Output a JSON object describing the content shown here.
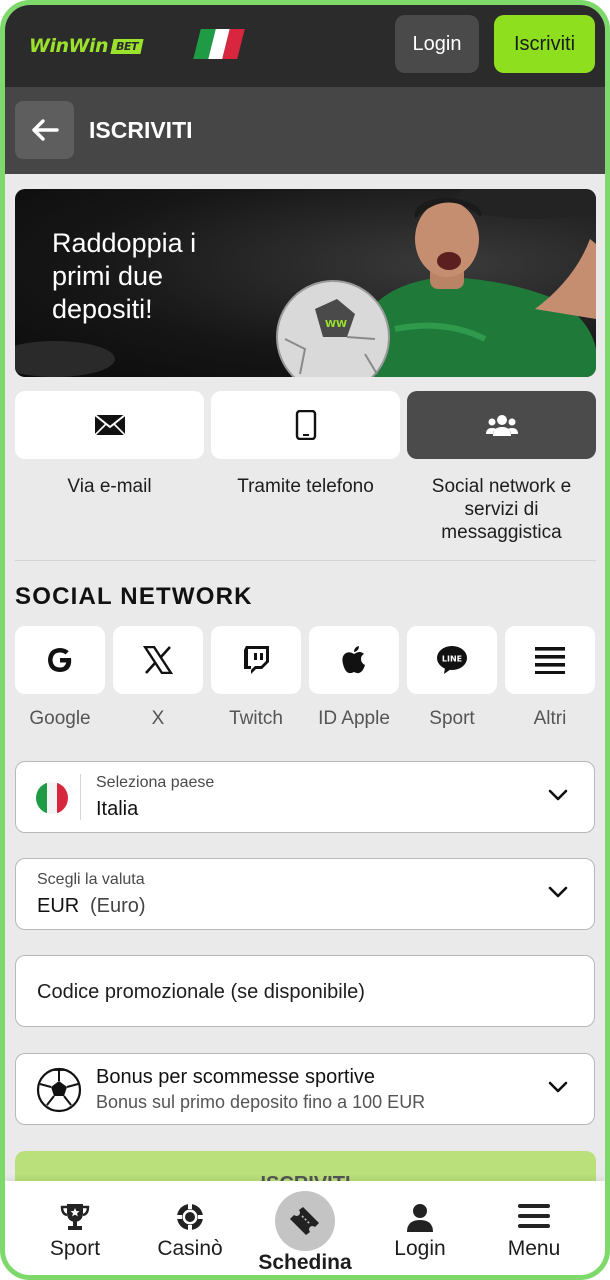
{
  "header": {
    "logo_text": "WinWin",
    "logo_badge": "BET",
    "country_flag": "italy-flag-icon",
    "login_label": "Login",
    "signup_label": "Iscriviti"
  },
  "titlebar": {
    "title": "ISCRIVITI"
  },
  "banner": {
    "headline": "Raddoppia i primi due depositi!"
  },
  "methods": [
    {
      "label": "Via e-mail",
      "icon": "envelope-icon"
    },
    {
      "label": "Tramite telefono",
      "icon": "phone-icon"
    },
    {
      "label": "Social network e servizi di messaggistica",
      "icon": "users-icon"
    }
  ],
  "social_section": {
    "title": "SOCIAL NETWORK",
    "items": [
      {
        "label": "Google",
        "icon": "google-icon"
      },
      {
        "label": "X",
        "icon": "x-icon"
      },
      {
        "label": "Twitch",
        "icon": "twitch-icon"
      },
      {
        "label": "ID Apple",
        "icon": "apple-icon"
      },
      {
        "label": "Sport",
        "icon": "line-icon"
      },
      {
        "label": "Altri",
        "icon": "menu-icon"
      }
    ]
  },
  "form": {
    "country": {
      "label": "Seleziona paese",
      "value": "Italia"
    },
    "currency": {
      "label": "Scegli la valuta",
      "code": "EUR",
      "name": "(Euro)"
    },
    "promo": {
      "placeholder": "Codice promozionale (se disponibile)"
    },
    "bonus": {
      "title": "Bonus per scommesse sportive",
      "subtitle": "Bonus sul primo deposito fino a 100 EUR"
    },
    "submit_label": "ISCRIVITI"
  },
  "bottom_nav": [
    {
      "label": "Sport",
      "icon": "trophy-icon"
    },
    {
      "label": "Casinò",
      "icon": "casino-chip-icon"
    },
    {
      "label": "Schedina",
      "icon": "ticket-icon"
    },
    {
      "label": "Login",
      "icon": "user-icon"
    },
    {
      "label": "Menu",
      "icon": "hamburger-icon"
    }
  ],
  "colors": {
    "accent_green": "#8ee01f",
    "frame_border": "#7dd96a",
    "header_bg": "#2b2b2b",
    "titlebar_bg": "#464646",
    "page_bg": "#eaeaea"
  }
}
